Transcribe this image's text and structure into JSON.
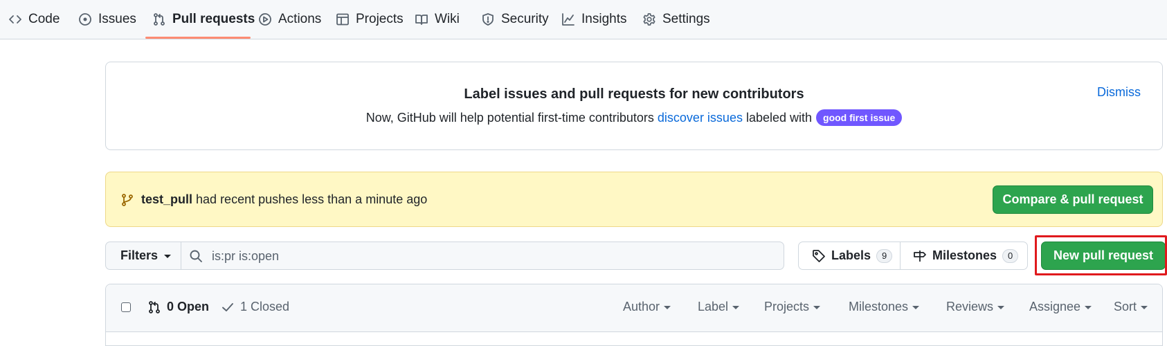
{
  "nav": {
    "items": [
      {
        "label": "Code",
        "icon": "code-icon"
      },
      {
        "label": "Issues",
        "icon": "issue-opened-icon"
      },
      {
        "label": "Pull requests",
        "icon": "git-pull-request-icon",
        "selected": true
      },
      {
        "label": "Actions",
        "icon": "play-icon"
      },
      {
        "label": "Projects",
        "icon": "table-icon"
      },
      {
        "label": "Wiki",
        "icon": "book-icon"
      },
      {
        "label": "Security",
        "icon": "shield-icon"
      },
      {
        "label": "Insights",
        "icon": "graph-icon"
      },
      {
        "label": "Settings",
        "icon": "gear-icon"
      }
    ]
  },
  "banner": {
    "title": "Label issues and pull requests for new contributors",
    "text_before": "Now, GitHub will help potential first-time contributors",
    "link": "discover issues",
    "text_after": "labeled with",
    "label": "good first issue",
    "label_color": "#7057ff",
    "dismiss": "Dismiss"
  },
  "recent_push": {
    "branch": "test_pull",
    "message": "had recent pushes less than a minute ago",
    "button": "Compare & pull request"
  },
  "toolbar": {
    "filters": "Filters",
    "search_value": "is:pr is:open",
    "labels": "Labels",
    "labels_count": "9",
    "milestones": "Milestones",
    "milestones_count": "0",
    "new_pr": "New pull request"
  },
  "list_header": {
    "open": "0 Open",
    "closed": "1 Closed",
    "menus": [
      "Author",
      "Label",
      "Projects",
      "Milestones",
      "Reviews",
      "Assignee",
      "Sort"
    ]
  },
  "colors": {
    "accent_green": "#2da44e",
    "link_blue": "#0969da",
    "flash_yellow": "#fff8c5",
    "selected_underline": "#fd8c73",
    "highlight_red": "#e0191d"
  }
}
